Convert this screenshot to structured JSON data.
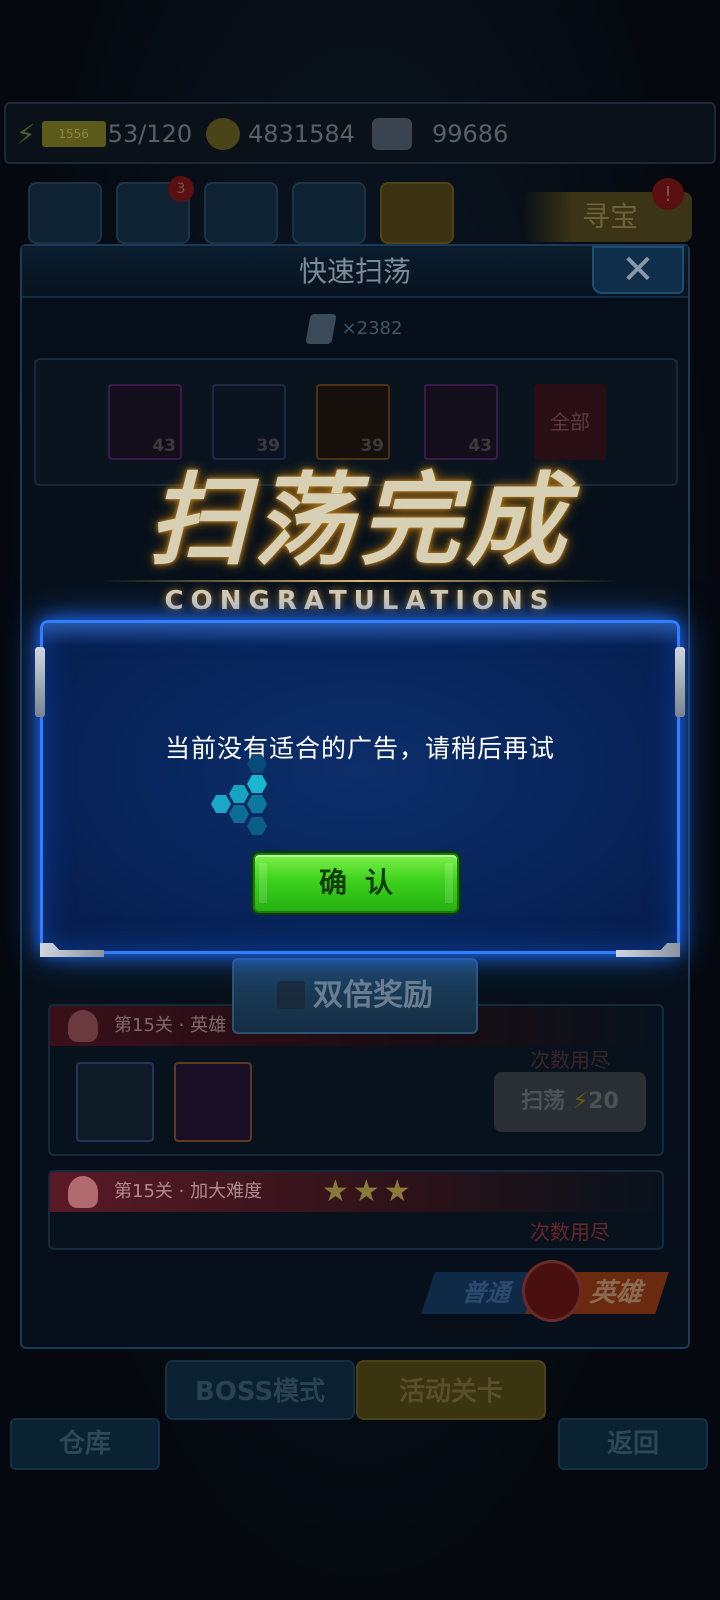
{
  "topbar": {
    "energy_level": "1556",
    "energy": "53/120",
    "gold": "4831584",
    "gems": "99686"
  },
  "nav": {
    "badge_count": "3",
    "treasure_label": "寻宝",
    "treasure_badge": "!"
  },
  "panel": {
    "title": "快速扫荡",
    "close": "✕",
    "ticket_count": "×2382",
    "items": [
      {
        "count": "43"
      },
      {
        "count": "39"
      },
      {
        "count": "39"
      },
      {
        "count": "43"
      }
    ],
    "all_label": "全部",
    "stage_a": {
      "title": "第15关 · 英雄",
      "status": "次数用尽",
      "sweep": "扫荡",
      "cost": "20"
    },
    "stage_b": {
      "title": "第15关 · 加大难度",
      "stars": "★★★",
      "status": "次数用尽"
    },
    "double_reward": "双倍奖励",
    "mode_normal": "普通",
    "mode_hero": "英雄"
  },
  "congrats": {
    "title_cn": "扫荡完成",
    "title_en": "CONGRATULATIONS"
  },
  "bottom": {
    "boss": "BOSS模式",
    "event": "活动关卡",
    "warehouse": "仓库",
    "back": "返回"
  },
  "dialog": {
    "message": "当前没有适合的广告，请稍后再试",
    "confirm": "确认"
  },
  "colors": {
    "dialog_border": "#2f7fff",
    "dialog_bg": "#08245a",
    "confirm_green": "#3ed21c"
  }
}
